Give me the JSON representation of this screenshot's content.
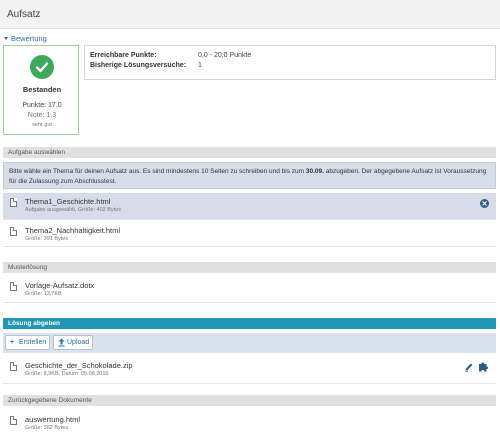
{
  "page": {
    "title": "Aufsatz"
  },
  "bewertung": {
    "toggle_label": "Bewertung",
    "status": "Bestanden",
    "points_line": "Punkte: 17,0",
    "grade_line": "Note: 1,3",
    "grade_text": "sehr gut",
    "status_color": "#3ba85a",
    "info": [
      {
        "label": "Erreichbare Punkte:",
        "value": "0,0 - 20,0 Punkte"
      },
      {
        "label": "Bisherige Lösungsversuche:",
        "value": "1"
      }
    ]
  },
  "aufgabe": {
    "header": "Aufgabe auswählen",
    "instructions_part1": "Bitte wähle ein Thema für deinen Aufsatz aus. Es sind mindestens 10 Seiten zu schreiben und bis zum ",
    "instructions_bold": "30.09.",
    "instructions_part2": " abzugeben. Der abgegebene Aufsatz ist Voraussetzung für die Zulassung zum Abschlusstest.",
    "files": [
      {
        "name": "Thema1_Geschichte.html",
        "meta": "Aufgabe ausgewählt, Größe: 402 Bytes",
        "selected": true
      },
      {
        "name": "Thema2_Nachhaltigkeit.html",
        "meta": "Größe: 391 Bytes",
        "selected": false
      }
    ]
  },
  "musterloesung": {
    "header": "Musterlösung",
    "files": [
      {
        "name": "Vorlage-Aufsatz.dotx",
        "meta": "Größe: 13,7KB"
      }
    ]
  },
  "loesung": {
    "header": "Lösung abgeben",
    "header_color": "#2197b7",
    "create_label": "Erstellen",
    "upload_label": "Upload",
    "files": [
      {
        "name": "Geschichte_der_Schokolade.zip",
        "meta": "Größe: 8,9KB, Datum: 05.08.2016"
      }
    ]
  },
  "zurueck": {
    "header": "Zurückgegebene Dokumente",
    "files": [
      {
        "name": "auswertung.html",
        "meta": "Größe: 362 Bytes"
      }
    ]
  }
}
